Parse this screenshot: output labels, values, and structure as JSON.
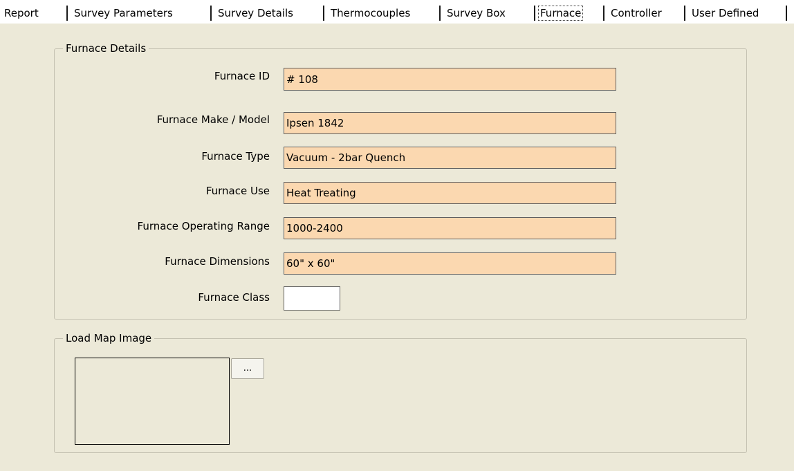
{
  "tabs": [
    {
      "label": "Report"
    },
    {
      "label": "Survey Parameters"
    },
    {
      "label": "Survey Details"
    },
    {
      "label": "Thermocouples"
    },
    {
      "label": "Survey Box"
    },
    {
      "label": "Furnace",
      "active": true
    },
    {
      "label": "Controller"
    },
    {
      "label": "User Defined"
    }
  ],
  "furnace_details": {
    "title": "Furnace Details",
    "fields": [
      {
        "label": "Furnace ID",
        "value": "# 108"
      },
      {
        "label": "Furnace Make / Model",
        "value": "Ipsen 1842"
      },
      {
        "label": "Furnace Type",
        "value": "Vacuum - 2bar Quench"
      },
      {
        "label": "Furnace Use",
        "value": "Heat Treating"
      },
      {
        "label": "Furnace Operating Range",
        "value": "1000-2400"
      },
      {
        "label": "Furnace Dimensions",
        "value": "60\" x 60\""
      },
      {
        "label": "Furnace Class",
        "value": ""
      }
    ]
  },
  "load_map": {
    "title": "Load Map Image",
    "browse_label": "..."
  },
  "colors": {
    "tab_bar_background": "#ffffff",
    "panel_background": "#ece9d8",
    "input_background": "#fbd8b0",
    "group_border": "#c4c1b1"
  }
}
